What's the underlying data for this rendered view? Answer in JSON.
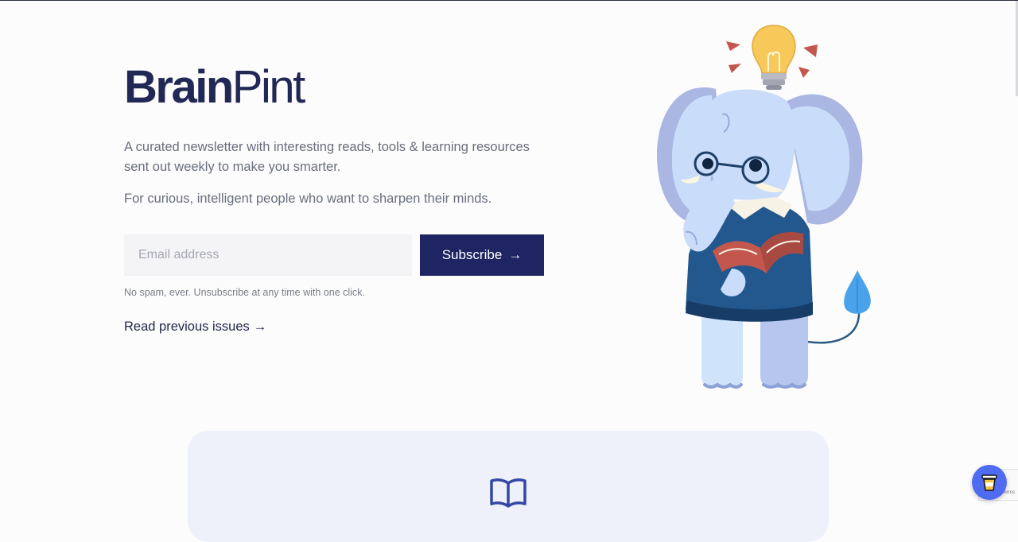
{
  "brand": {
    "part1": "Brain",
    "part2": "Pint"
  },
  "hero": {
    "description": "A curated newsletter with interesting reads, tools & learning resources sent out weekly to make you smarter.",
    "tagline": "For curious, intelligent people who want to sharpen their minds."
  },
  "form": {
    "email_placeholder": "Email address",
    "subscribe_label": "Subscribe",
    "subscribe_arrow": "→",
    "note": "No spam, ever. Unsubscribe at any time with one click."
  },
  "links": {
    "previous_issues": "Read previous issues",
    "previous_issues_arrow": "→"
  },
  "recaptcha": {
    "label": "Privacy - Terms"
  },
  "colors": {
    "brand_navy": "#222855",
    "button_bg": "#1f2462",
    "accent_blue": "#4e6bf2",
    "elephant_blue": "#cfe3fb",
    "card_bg": "#eef1fa"
  },
  "icons": {
    "illustration": "elephant-with-book-and-lightbulb",
    "card": "open-book-icon",
    "floating": "coffee-cup-icon"
  }
}
